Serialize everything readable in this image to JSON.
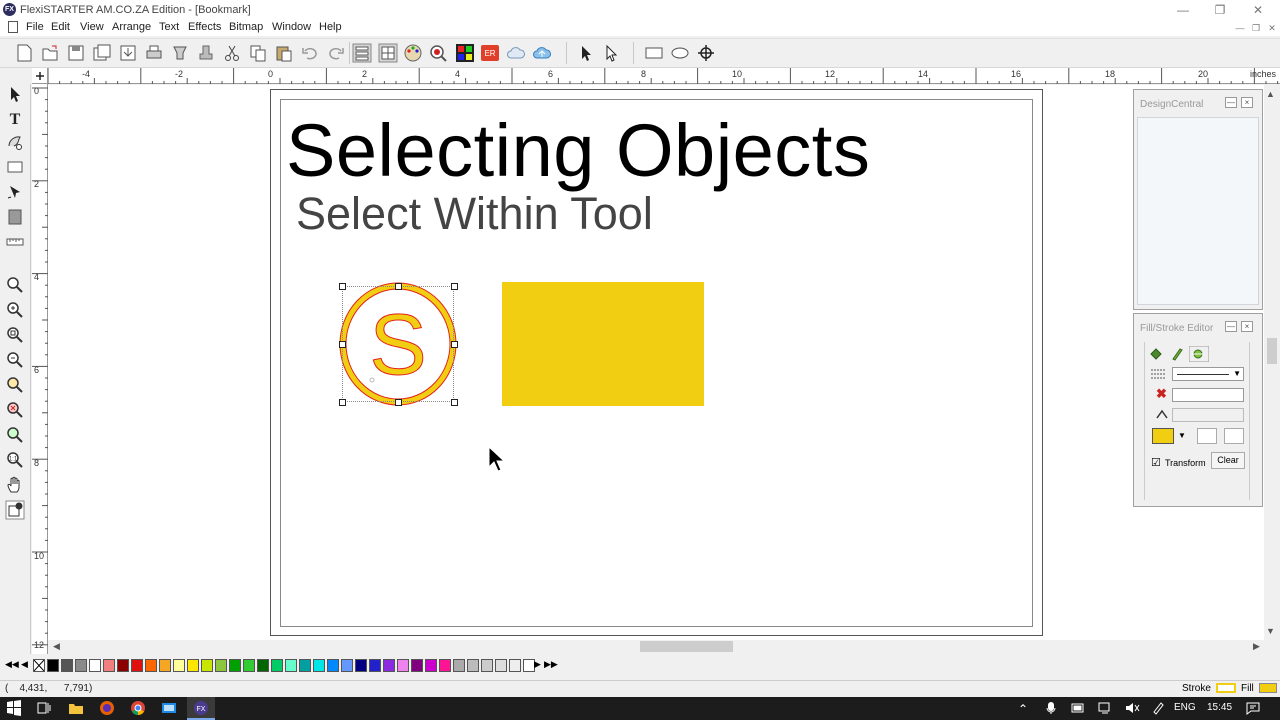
{
  "window": {
    "title": "FlexiSTARTER AM.CO.ZA Edition - [Bookmark]",
    "app_icon_text": "FX"
  },
  "menu": [
    "File",
    "Edit",
    "View",
    "Arrange",
    "Text",
    "Effects",
    "Bitmap",
    "Window",
    "Help"
  ],
  "toolbar_icons": [
    "new-icon",
    "open-icon",
    "save-icon",
    "save-as-icon",
    "import-icon",
    "print-icon",
    "cut-tool-icon",
    "output-icon",
    "cut-icon",
    "copy-icon",
    "paste-icon",
    "undo-icon",
    "redo-icon",
    "layers-icon",
    "grid-icon",
    "palette-icon",
    "color-picker-icon",
    "color-grid-icon",
    "er-icon",
    "cloud-icon",
    "cloud-upload-icon",
    "select-arrow-icon",
    "select-within-icon",
    "rectangle-icon",
    "ellipse-icon",
    "node-icon"
  ],
  "ruler": {
    "unit": "inches",
    "top_labels": [
      "-4",
      "-2",
      "0",
      "2",
      "4",
      "6",
      "8",
      "10",
      "12",
      "14",
      "16",
      "18",
      "20"
    ],
    "left_labels": [
      "0",
      "2",
      "4",
      "6",
      "8",
      "10",
      "12"
    ]
  },
  "tools": [
    "select-tool-icon",
    "text-tool-icon",
    "shape-tool-icon",
    "rectangle-tool-icon",
    "pen-tool-icon",
    "fill-tool-icon",
    "measure-tool-icon",
    "zoom-icon",
    "zoom-in-icon",
    "zoom-page-icon",
    "zoom-out-icon",
    "zoom-all-icon",
    "zoom-selection-icon",
    "zoom-previous-icon",
    "zoom-actual-icon",
    "pan-hand-icon",
    "view-mode-icon"
  ],
  "document": {
    "headline": "Selecting Objects",
    "subhead": "Select Within Tool",
    "circle_letter": "S",
    "fill_color": "#f2ce12",
    "stroke_color": "#e2231a"
  },
  "panels": {
    "design_central": {
      "title": "DesignCentral"
    },
    "fill_stroke": {
      "title": "Fill/Stroke Editor",
      "transform_label": "Transform",
      "transform_checked": "☑",
      "clear_label": "Clear"
    }
  },
  "palette_colors": [
    "#000000",
    "#555555",
    "#8a8a8a",
    "#ffffff",
    "#f08080",
    "#8b0000",
    "#e01010",
    "#ff6600",
    "#f5a623",
    "#ffff99",
    "#ffe600",
    "#c8e600",
    "#8cc63f",
    "#00a000",
    "#33cc33",
    "#006600",
    "#00cc66",
    "#66ffcc",
    "#00a0a0",
    "#00e5e5",
    "#0088ff",
    "#6699ff",
    "#000080",
    "#2222cc",
    "#8a2be2",
    "#ee82ee",
    "#800080",
    "#cc00cc",
    "#ff1493",
    "#aaaaaa",
    "#bbbbbb",
    "#cccccc",
    "#dddddd",
    "#eeeeee",
    "#ffffff"
  ],
  "status": {
    "coords": "(    4,431,      7,791)",
    "stroke_label": "Stroke",
    "fill_label": "Fill",
    "stroke_swatch": "#f2ce12",
    "fill_swatch": "#f2ce12"
  },
  "taskbar": {
    "language": "ENG",
    "time": "15:45"
  }
}
